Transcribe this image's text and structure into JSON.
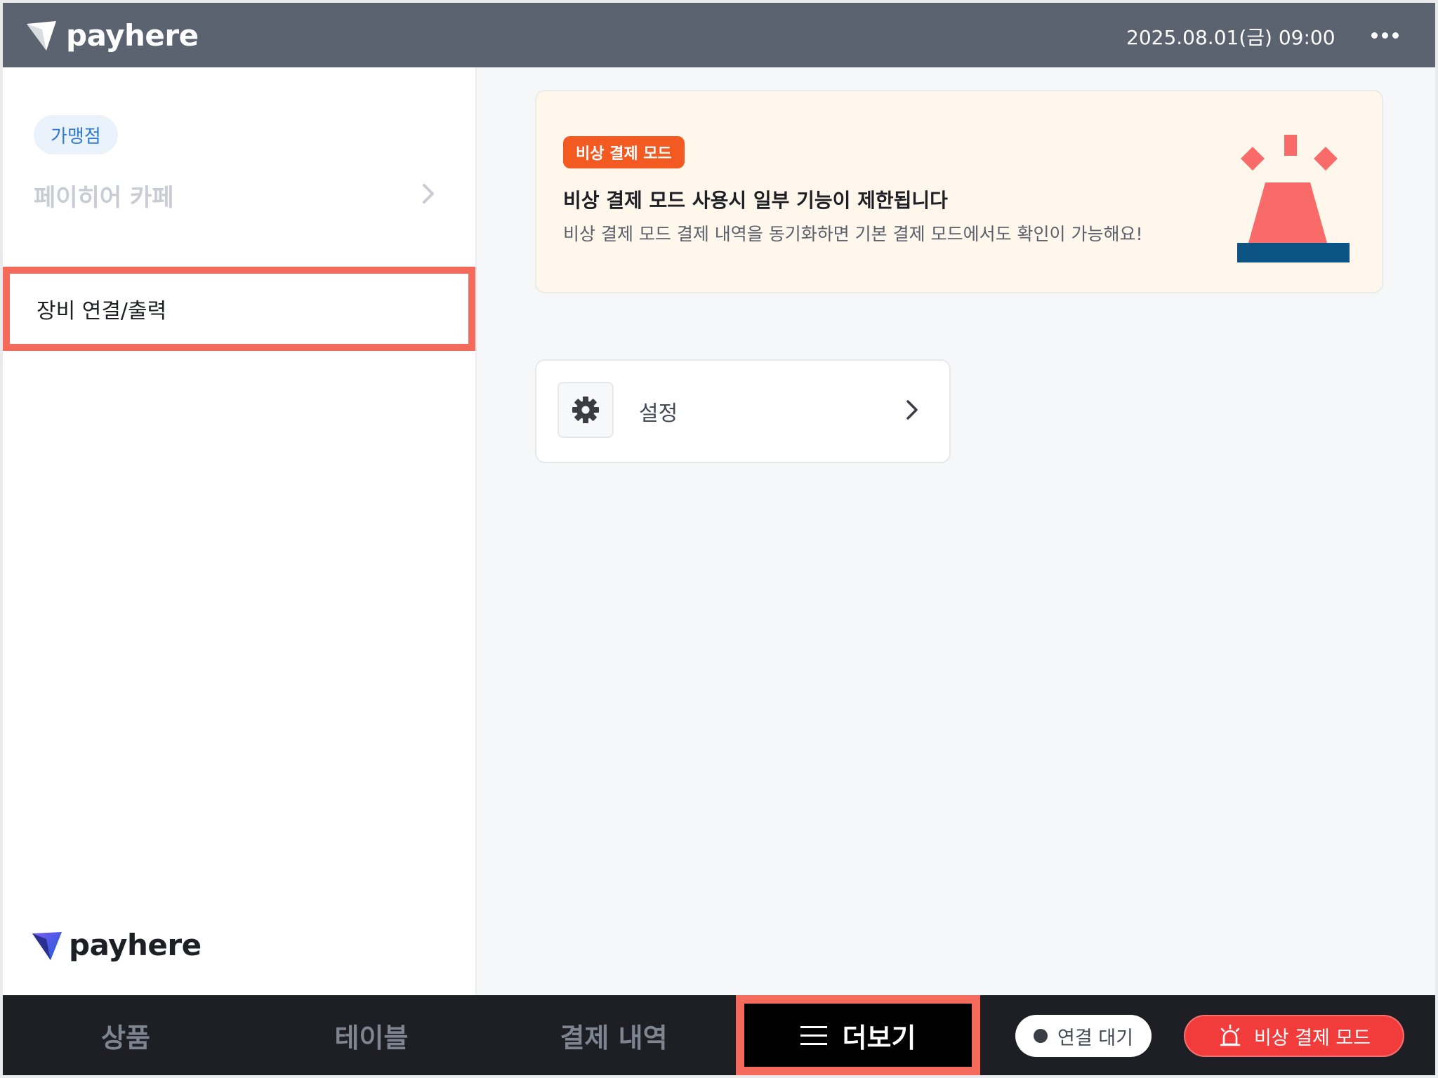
{
  "header": {
    "logo_text": "payhere",
    "datetime": "2025.08.01(금) 09:00"
  },
  "sidebar": {
    "store_badge": "가맹점",
    "store_name": "페이히어 카페",
    "menu_item": "장비 연결/출력",
    "logo_text": "payhere"
  },
  "alert": {
    "badge": "비상 결제 모드",
    "title": "비상 결제 모드 사용시 일부 기능이 제한됩니다",
    "description": "비상 결제 모드 결제 내역을 동기화하면 기본 결제 모드에서도 확인이 가능해요!"
  },
  "settings": {
    "label": "설정"
  },
  "bottom": {
    "tabs": [
      {
        "label": "상품"
      },
      {
        "label": "테이블"
      },
      {
        "label": "결제 내역"
      },
      {
        "label": "더보기"
      }
    ],
    "connection_label": "연결 대기",
    "emergency_label": "비상 결제 모드"
  },
  "colors": {
    "header_bg": "#5b6270",
    "highlight": "#f46a5c",
    "badge_orange": "#f25a22",
    "emergency_red": "#f23c3c",
    "siren_coral": "#f96b69",
    "siren_base": "#0b5483"
  },
  "icons": [
    "payhere-logo-icon",
    "chevron-right-icon",
    "gear-icon",
    "siren-icon",
    "hamburger-icon",
    "alarm-icon"
  ]
}
